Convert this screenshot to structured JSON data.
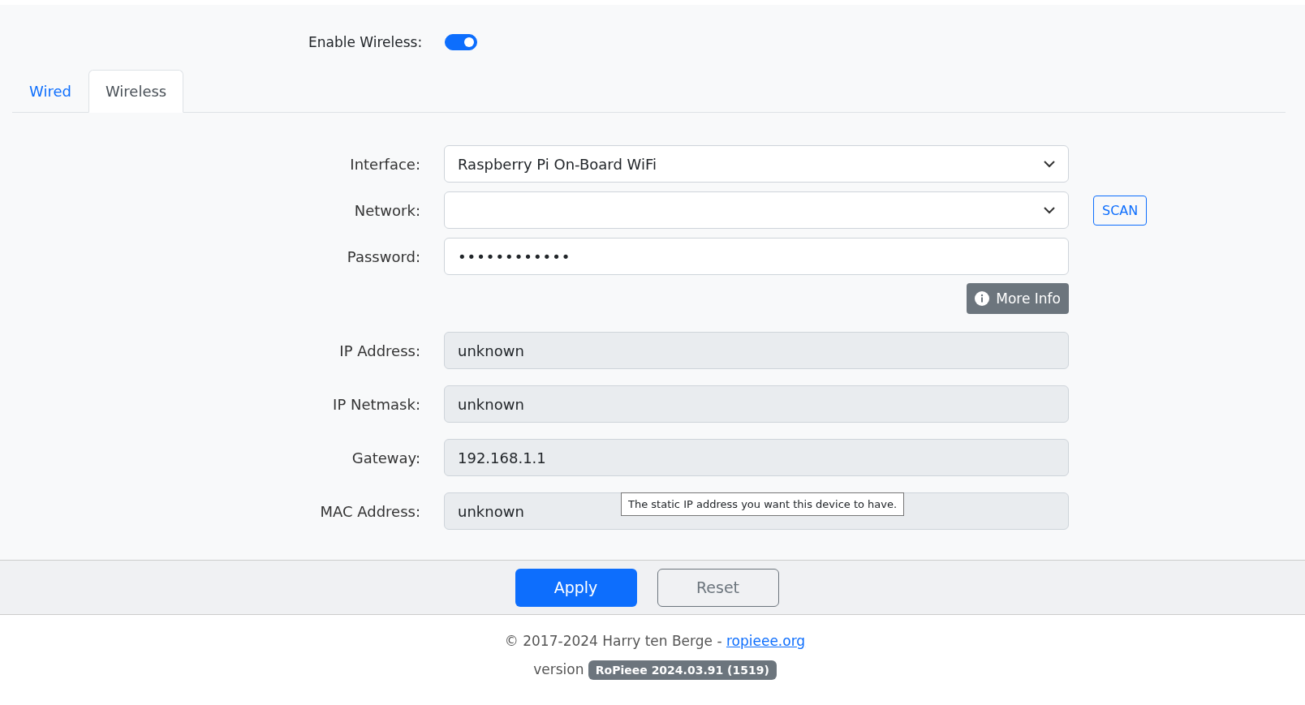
{
  "enable_wireless": {
    "label": "Enable Wireless:",
    "on": true
  },
  "tabs": [
    {
      "label": "Wired",
      "selected": false
    },
    {
      "label": "Wireless",
      "selected": true
    }
  ],
  "fields": [
    {
      "label": "Interface:",
      "kind": "select",
      "value": "Raspberry Pi On-Board WiFi"
    },
    {
      "label": "Network:",
      "kind": "select",
      "button": "SCAN"
    },
    {
      "label": "Password:",
      "kind": "password",
      "value": "••••••••••••",
      "info_button": "More Info"
    },
    {
      "label": "IP Address:",
      "kind": "readonly",
      "value": "unknown"
    },
    {
      "label": "IP Netmask:",
      "kind": "readonly",
      "value": "unknown"
    },
    {
      "label": "Gateway:",
      "kind": "readonly",
      "value": "192.168.1.1"
    },
    {
      "label": "MAC Address:",
      "kind": "readonly",
      "value": "unknown"
    }
  ],
  "tooltip": "The static IP address you want this device to have.",
  "buttons": {
    "apply": "Apply",
    "reset": "Reset"
  },
  "footer": {
    "copyright": "© 2017-2024 Harry ten Berge -",
    "link": "ropieee.org",
    "version_label": "version",
    "version": "RoPieee 2024.03.91 (1519)"
  }
}
